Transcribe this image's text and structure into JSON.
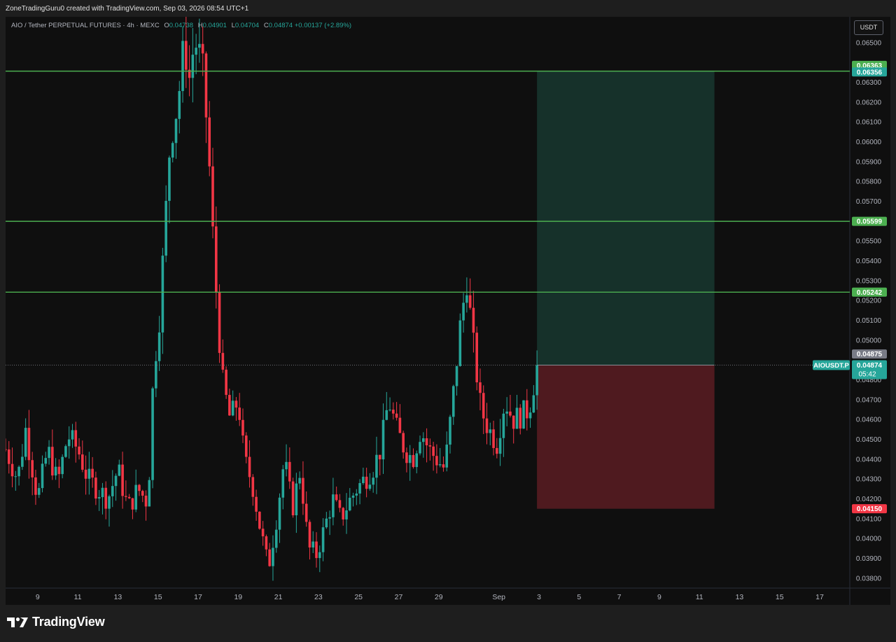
{
  "credit": "ZoneTradingGuru0 created with TradingView.com, Sep 03, 2026 08:54 UTC+1",
  "legend": {
    "symbol": "AIO / Tether PERPETUAL FUTURES · 4h · MEXC",
    "o_label": "O",
    "o_value": "0.04738",
    "h_label": "H",
    "h_value": "0.04901",
    "l_label": "L",
    "l_value": "0.04704",
    "c_label": "C",
    "c_value": "0.04874",
    "change": "+0.00137 (+2.89%)"
  },
  "currency_button": "USDT",
  "brand": "TradingView",
  "colors": {
    "up": "#26a69a",
    "down": "#f23645",
    "level": "#4caf50",
    "bg": "#0f0f0f"
  },
  "chart_data": {
    "type": "candlestick",
    "symbol_label": "AIOUSDT.P",
    "timeframe": "4h",
    "ylim": [
      0.0375,
      0.0663
    ],
    "y_ticks": [
      "0.06500",
      "0.06300",
      "0.06200",
      "0.06100",
      "0.06000",
      "0.05900",
      "0.05800",
      "0.05700",
      "0.05500",
      "0.05400",
      "0.05300",
      "0.05200",
      "0.05100",
      "0.05000",
      "0.04800",
      "0.04700",
      "0.04600",
      "0.04500",
      "0.04400",
      "0.04300",
      "0.04200",
      "0.04100",
      "0.04000",
      "0.03900",
      "0.03800"
    ],
    "x_ticks": [
      {
        "label": "9",
        "day": 9
      },
      {
        "label": "11",
        "day": 11
      },
      {
        "label": "13",
        "day": 13
      },
      {
        "label": "15",
        "day": 15
      },
      {
        "label": "17",
        "day": 17
      },
      {
        "label": "19",
        "day": 19
      },
      {
        "label": "21",
        "day": 21
      },
      {
        "label": "23",
        "day": 23
      },
      {
        "label": "25",
        "day": 25
      },
      {
        "label": "27",
        "day": 27
      },
      {
        "label": "29",
        "day": 29
      },
      {
        "label": "Sep",
        "day": 32
      },
      {
        "label": "3",
        "day": 34
      },
      {
        "label": "5",
        "day": 36
      },
      {
        "label": "7",
        "day": 38
      },
      {
        "label": "9",
        "day": 40
      },
      {
        "label": "11",
        "day": 42
      },
      {
        "label": "13",
        "day": 44
      },
      {
        "label": "15",
        "day": 46
      },
      {
        "label": "17",
        "day": 48
      }
    ],
    "xlim_days": [
      7.4,
      49.5
    ],
    "levels": [
      {
        "price": "0.06356",
        "value": 0.06356
      },
      {
        "price": "0.05599",
        "value": 0.05599
      },
      {
        "price": "0.05242",
        "value": 0.05242
      }
    ],
    "price_tags": [
      {
        "text": "0.06363",
        "value": 0.06363,
        "color": "#4caf50"
      },
      {
        "text": "0.06356",
        "value": 0.06356,
        "color": "#26a69a"
      },
      {
        "text": "0.05599",
        "value": 0.05599,
        "color": "#4caf50"
      },
      {
        "text": "0.05242",
        "value": 0.05242,
        "color": "#4caf50"
      },
      {
        "text": "0.04875",
        "value": 0.04875,
        "color": "#787b86"
      },
      {
        "text": "0.04150",
        "value": 0.0415,
        "color": "#f23645"
      }
    ],
    "last_price": {
      "text": "0.04874",
      "value": 0.04874,
      "countdown": "05:42"
    },
    "position": {
      "entry": 0.04874,
      "target": 0.06356,
      "stop": 0.0415,
      "start_day": 33.9,
      "end_day": 42.75
    },
    "anchors": [
      [
        7.4,
        0.0445
      ],
      [
        8.0,
        0.043
      ],
      [
        8.4,
        0.0455
      ],
      [
        9.0,
        0.042
      ],
      [
        9.5,
        0.0445
      ],
      [
        10.0,
        0.0428
      ],
      [
        10.5,
        0.0452
      ],
      [
        11.0,
        0.0445
      ],
      [
        11.5,
        0.043
      ],
      [
        12.0,
        0.0425
      ],
      [
        12.5,
        0.042
      ],
      [
        13.0,
        0.0435
      ],
      [
        13.5,
        0.0415
      ],
      [
        14.0,
        0.0425
      ],
      [
        14.5,
        0.0418
      ],
      [
        14.8,
        0.049
      ],
      [
        15.0,
        0.05
      ],
      [
        15.3,
        0.055
      ],
      [
        15.6,
        0.06
      ],
      [
        16.0,
        0.062
      ],
      [
        16.3,
        0.065
      ],
      [
        16.6,
        0.063
      ],
      [
        16.8,
        0.0652
      ],
      [
        17.2,
        0.064
      ],
      [
        17.5,
        0.06
      ],
      [
        17.8,
        0.054
      ],
      [
        18.2,
        0.048
      ],
      [
        18.6,
        0.046
      ],
      [
        19.0,
        0.047
      ],
      [
        19.3,
        0.044
      ],
      [
        19.7,
        0.0428
      ],
      [
        20.1,
        0.0405
      ],
      [
        20.5,
        0.0385
      ],
      [
        20.9,
        0.041
      ],
      [
        21.3,
        0.044
      ],
      [
        21.7,
        0.0415
      ],
      [
        22.1,
        0.0435
      ],
      [
        22.5,
        0.0395
      ],
      [
        22.9,
        0.0392
      ],
      [
        23.3,
        0.0405
      ],
      [
        23.7,
        0.042
      ],
      [
        24.1,
        0.041
      ],
      [
        24.5,
        0.0418
      ],
      [
        24.9,
        0.0425
      ],
      [
        25.3,
        0.043
      ],
      [
        25.7,
        0.0435
      ],
      [
        26.1,
        0.0445
      ],
      [
        26.5,
        0.047
      ],
      [
        26.9,
        0.0455
      ],
      [
        27.3,
        0.0445
      ],
      [
        27.7,
        0.044
      ],
      [
        28.1,
        0.0455
      ],
      [
        28.5,
        0.0445
      ],
      [
        28.9,
        0.044
      ],
      [
        29.3,
        0.0435
      ],
      [
        29.7,
        0.047
      ],
      [
        30.1,
        0.051
      ],
      [
        30.4,
        0.053
      ],
      [
        30.7,
        0.05
      ],
      [
        31.1,
        0.0465
      ],
      [
        31.5,
        0.0455
      ],
      [
        31.9,
        0.0448
      ],
      [
        32.3,
        0.047
      ],
      [
        32.7,
        0.046
      ],
      [
        33.1,
        0.0462
      ],
      [
        33.5,
        0.0465
      ],
      [
        33.9,
        0.0487
      ]
    ]
  }
}
